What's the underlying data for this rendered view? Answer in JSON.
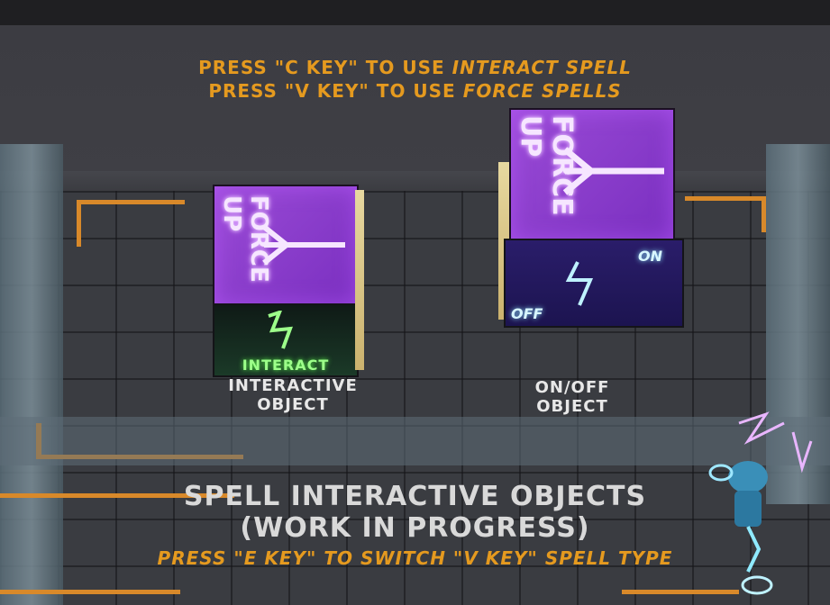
{
  "hud": {
    "line1_prefix": "PRESS \"C KEY\" TO USE ",
    "line1_spell": "INTERACT SPELL",
    "line2_prefix": "PRESS \"V KEY\" TO USE ",
    "line2_spell": "FORCE SPELLS"
  },
  "cube_left": {
    "top_text": "FORCE UP",
    "front_text": "INTERACT",
    "label_line1": "INTERACTIVE",
    "label_line2": "OBJECT"
  },
  "cube_right": {
    "top_text": "FORCE UP",
    "on_text": "ON",
    "off_text": "OFF",
    "label_line1": "ON/OFF",
    "label_line2": "OBJECT"
  },
  "banner": {
    "title_line1": "SPELL INTERACTIVE OBJECTS",
    "title_line2": "(WORK IN PROGRESS)",
    "subtitle": "PRESS \"E KEY\" TO SWITCH \"V KEY\" SPELL TYPE"
  },
  "colors": {
    "accent_orange": "#e59a1f",
    "force_purple": "#8a3fcf",
    "interact_green": "#7cff86",
    "onoff_cyan": "#9fe8ff"
  }
}
